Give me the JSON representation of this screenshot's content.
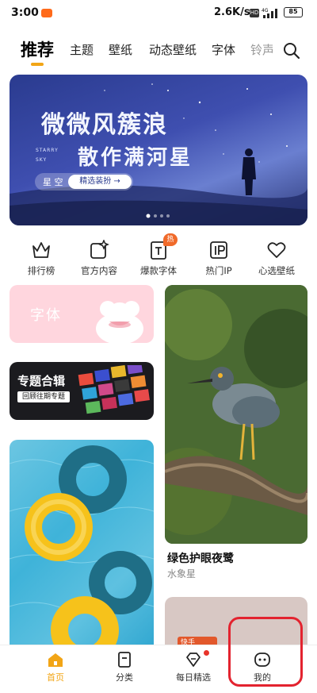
{
  "status_bar": {
    "time": "3:00",
    "net_speed": "2.6K/s",
    "hd": "HD",
    "network": "4G",
    "battery": "85"
  },
  "top_tabs": [
    "推荐",
    "主题",
    "壁纸",
    "动态壁纸",
    "字体",
    "铃声"
  ],
  "banner": {
    "line1": "微微风簇浪",
    "line2": "散作满河星",
    "en_line1": "STARRY",
    "en_line2": "SKY",
    "chip_label": "星 空",
    "chip_button": "精选装扮 →"
  },
  "quick_icons": [
    {
      "label": "排行榜",
      "icon": "crown-icon"
    },
    {
      "label": "官方内容",
      "icon": "sparkle-icon"
    },
    {
      "label": "爆款字体",
      "icon": "font-icon"
    },
    {
      "label": "热门IP",
      "icon": "ip-icon"
    },
    {
      "label": "心选壁纸",
      "icon": "heart-icon"
    }
  ],
  "hot_badge": "热",
  "cards": {
    "font_card": "字体",
    "topic_card": {
      "title": "专题合辑",
      "subtitle": "回顾往期专题"
    },
    "bird_card": {
      "title": "绿色护眼夜鹭",
      "author": "水象星"
    },
    "bottom_right_tag": "快手"
  },
  "bottom_nav": [
    {
      "label": "首页",
      "active": true,
      "icon": "home-icon"
    },
    {
      "label": "分类",
      "active": false,
      "icon": "category-icon"
    },
    {
      "label": "每日精选",
      "active": false,
      "icon": "diamond-icon"
    },
    {
      "label": "我的",
      "active": false,
      "icon": "profile-icon"
    }
  ],
  "colors": {
    "accent": "#f2a516",
    "badge": "#f06a2a",
    "highlight": "#e3232f"
  }
}
